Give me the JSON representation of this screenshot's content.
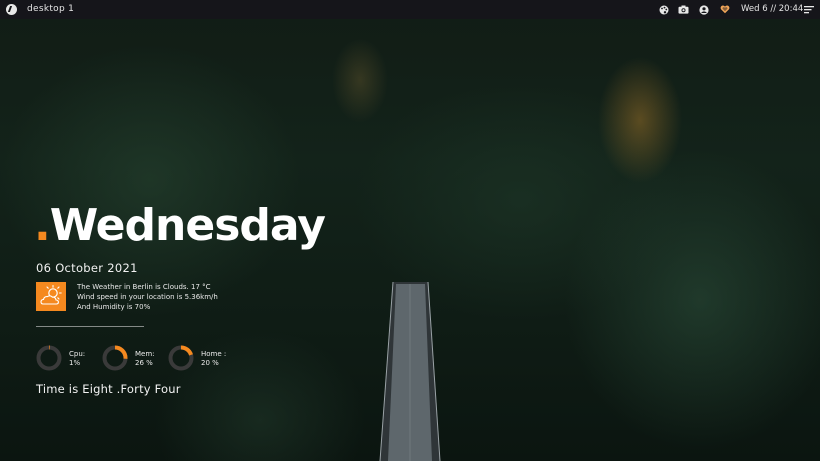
{
  "topbar": {
    "workspace_label": "desktop 1",
    "clock": "Wed 6 // 20:44",
    "tray_icons": [
      "palette-icon",
      "camera-icon",
      "user-icon",
      "heart-icon",
      "menu-icon"
    ]
  },
  "widget": {
    "day_dot": ".",
    "day_name": "Wednesday",
    "date": "06 October 2021",
    "weather": {
      "icon": "partly-cloudy-icon",
      "line1": "The Weather in Berlin is Clouds. 17 °C",
      "line2": "Wind speed in your location is 5.36km/h",
      "line3": "And Humidity is 70%"
    },
    "gauges": [
      {
        "name": "Cpu:",
        "value": "1%",
        "percent": 1
      },
      {
        "name": "Mem:",
        "value": "26 %",
        "percent": 26
      },
      {
        "name": "Home :",
        "value": "20 %",
        "percent": 20
      }
    ],
    "time_text": "Time is Eight .Forty Four"
  },
  "colors": {
    "accent": "#f5891f",
    "topbar_bg": "#15151a",
    "text": "#f2f2f2",
    "gauge_track": "#3a3a3a"
  }
}
